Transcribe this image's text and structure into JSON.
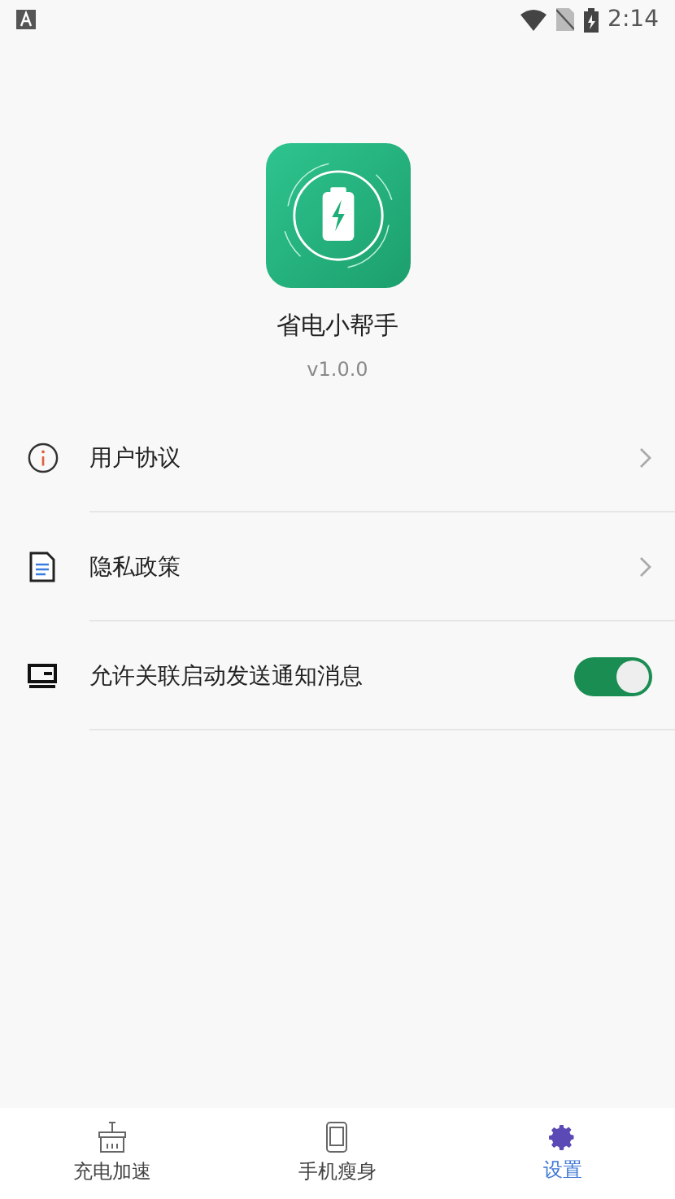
{
  "status_bar": {
    "time": "2:14"
  },
  "app": {
    "name": "省电小帮手",
    "version": "v1.0.0"
  },
  "settings": [
    {
      "kind": "link",
      "label": "用户协议"
    },
    {
      "kind": "link",
      "label": "隐私政策"
    },
    {
      "kind": "toggle",
      "label": "允许关联启动发送通知消息",
      "on": true
    }
  ],
  "tabs": [
    {
      "label": "充电加速",
      "selected": false
    },
    {
      "label": "手机瘦身",
      "selected": false
    },
    {
      "label": "设置",
      "selected": true
    }
  ]
}
